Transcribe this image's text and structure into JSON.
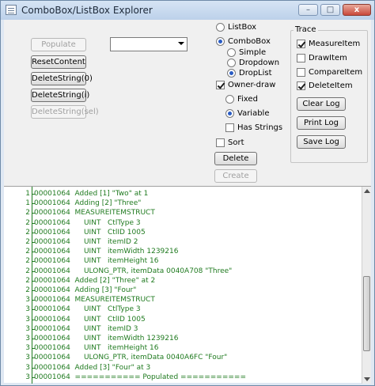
{
  "window": {
    "title": "ComboBox/ListBox Explorer",
    "minimize_glyph": "–",
    "maximize_glyph": "□",
    "close_glyph": "x"
  },
  "buttons": {
    "populate": "Populate",
    "reset_content": "ResetContent",
    "delete_string_0": "DeleteString(0)",
    "delete_string_i": "DeleteString(i)",
    "delete_string_sel": "DeleteString(sel)",
    "delete": "Delete",
    "create": "Create"
  },
  "combo": {
    "value": ""
  },
  "options": {
    "listbox": "ListBox",
    "combobox": "ComboBox",
    "simple": "Simple",
    "dropdown": "Dropdown",
    "droplist": "DropList",
    "owner_draw": "Owner-draw",
    "fixed": "Fixed",
    "variable": "Variable",
    "has_strings": "Has Strings",
    "sort": "Sort"
  },
  "trace": {
    "title": "Trace",
    "measure_item": "MeasureItem",
    "draw_item": "DrawItem",
    "compare_item": "CompareItem",
    "delete_item": "DeleteItem",
    "clear_log": "Clear Log",
    "print_log": "Print Log",
    "save_log": "Save Log"
  },
  "log": [
    {
      "gutter": "1",
      "text": "00001064  Added [1] \"Two\" at 1"
    },
    {
      "gutter": "1",
      "text": "00001064  Adding [2] \"Three\""
    },
    {
      "gutter": "2",
      "text": "00001064  MEASUREITEMSTRUCT"
    },
    {
      "gutter": "2",
      "text": "00001064      UINT   CtlType 3"
    },
    {
      "gutter": "2",
      "text": "00001064      UINT   CtlID 1005"
    },
    {
      "gutter": "2",
      "text": "00001064      UINT   itemID 2"
    },
    {
      "gutter": "2",
      "text": "00001064      UINT   itemWidth 1239216"
    },
    {
      "gutter": "2",
      "text": "00001064      UINT   itemHeight 16"
    },
    {
      "gutter": "2",
      "text": "00001064      ULONG_PTR, itemData 0040A708 \"Three\""
    },
    {
      "gutter": "2",
      "text": "00001064  Added [2] \"Three\" at 2"
    },
    {
      "gutter": "2",
      "text": "00001064  Adding [3] \"Four\""
    },
    {
      "gutter": "3",
      "text": "00001064  MEASUREITEMSTRUCT"
    },
    {
      "gutter": "3",
      "text": "00001064      UINT   CtlType 3"
    },
    {
      "gutter": "3",
      "text": "00001064      UINT   CtlID 1005"
    },
    {
      "gutter": "3",
      "text": "00001064      UINT   itemID 3"
    },
    {
      "gutter": "3",
      "text": "00001064      UINT   itemWidth 1239216"
    },
    {
      "gutter": "3",
      "text": "00001064      UINT   itemHeight 16"
    },
    {
      "gutter": "3",
      "text": "00001064      ULONG_PTR, itemData 0040A6FC \"Four\""
    },
    {
      "gutter": "3",
      "text": "00001064  Added [3] \"Four\" at 3"
    },
    {
      "gutter": "3",
      "text": "00001064  =========== Populated ==========="
    }
  ],
  "state": {
    "listbox": false,
    "combobox": true,
    "simple": false,
    "dropdown": false,
    "droplist": true,
    "owner_draw": true,
    "fixed": false,
    "variable": true,
    "has_strings": false,
    "sort": false,
    "measure_item": true,
    "draw_item": false,
    "compare_item": false,
    "delete_item": true
  },
  "scroll": {
    "position": 0.78,
    "thumb_fraction": 0.42
  }
}
